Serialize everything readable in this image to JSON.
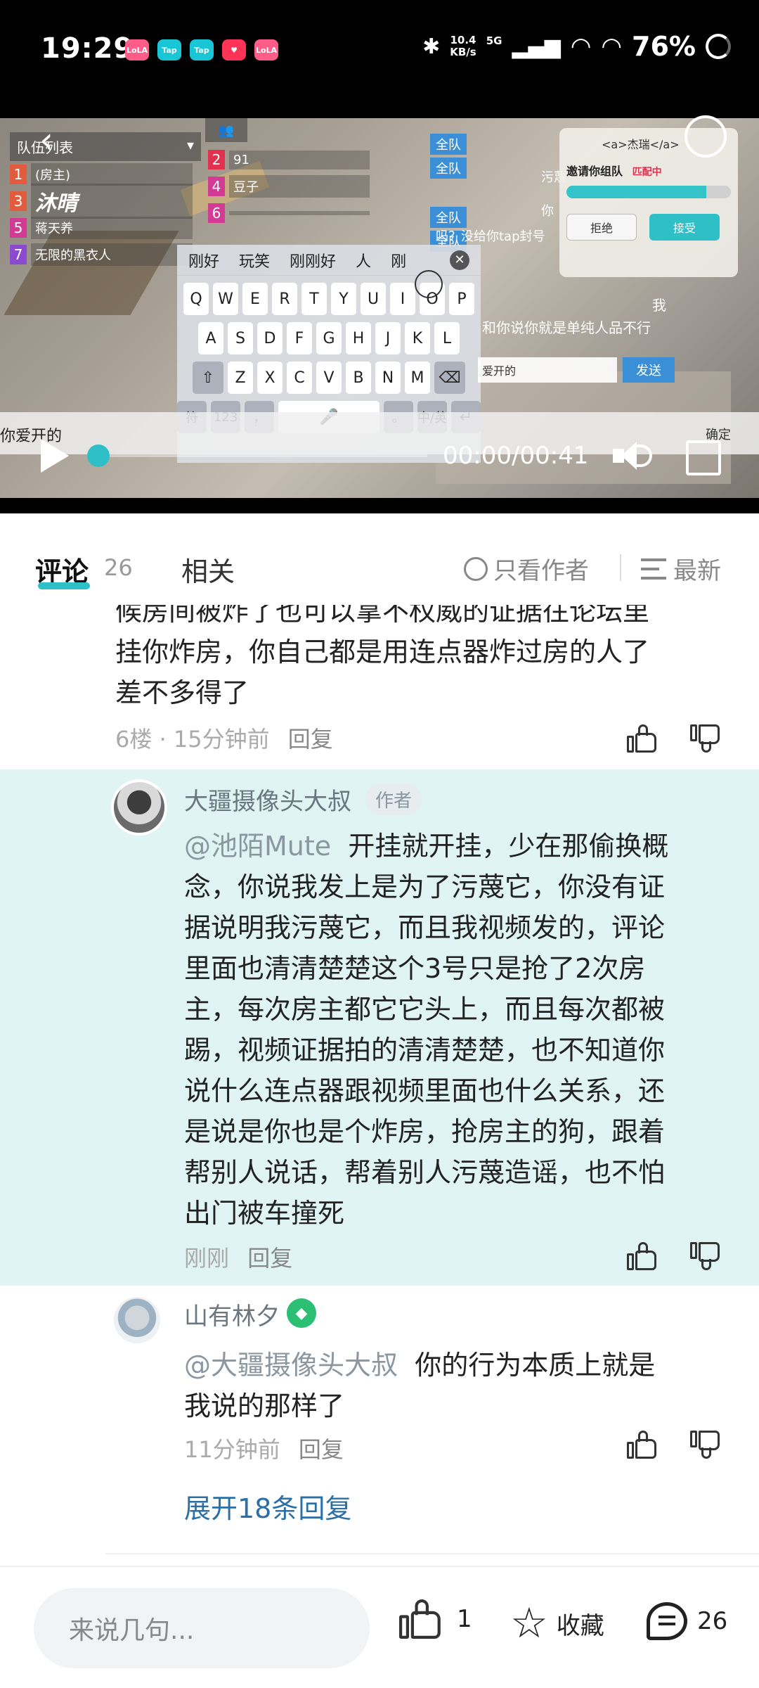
{
  "status_bar": {
    "time": "19:29",
    "apps": [
      {
        "label": "LoLA",
        "color": "#ff5c8a"
      },
      {
        "label": "Tap",
        "color": "#19c6d6"
      },
      {
        "label": "Tap",
        "color": "#19c6d6"
      },
      {
        "label": "♥",
        "color": "#ff3355"
      },
      {
        "label": "LoLA",
        "color": "#ff5c8a"
      }
    ],
    "net_speed_value": "10.4",
    "net_speed_unit": "KB/s",
    "network": "5G",
    "battery": "76%",
    "icons": [
      "bluetooth-icon",
      "signal-icon",
      "wifi-icon",
      "battery-ring-icon"
    ]
  },
  "video": {
    "team_list_label": "队伍列表",
    "team_col1": [
      {
        "num": "1",
        "name": "(房主)",
        "color": "#e25b3d"
      },
      {
        "num": "3",
        "name": "沐晴",
        "color": "#e25b3d"
      },
      {
        "num": "5",
        "name": "蒋天养",
        "color": "#d13b93"
      },
      {
        "num": "7",
        "name": "无限的黑衣人",
        "color": "#8c4ad0"
      }
    ],
    "team_col2": [
      {
        "num": "2",
        "name": "91",
        "color": "#e2314e"
      },
      {
        "num": "4",
        "name": "豆子",
        "color": "#d13b93"
      },
      {
        "num": "6",
        "name": "",
        "color": "#d13b93"
      }
    ],
    "chat_tags": [
      "全队",
      "全队",
      "全队",
      "全队"
    ],
    "chat_lines": [
      "污蔑",
      "你",
      "吗？没给你tap封号",
      "我",
      "和你说你就是单纯人品不行"
    ],
    "invite": {
      "title": "<a>杰瑞</a>",
      "text": "邀请你组队",
      "status": "匹配中",
      "reject": "拒绝",
      "accept": "接受",
      "progress": 0.85
    },
    "keyboard": {
      "suggestions": [
        "刚好",
        "玩笑",
        "刚刚好",
        "人",
        "刚"
      ],
      "row1": [
        "Q",
        "W",
        "E",
        "R",
        "T",
        "Y",
        "U",
        "I",
        "O",
        "P"
      ],
      "row2": [
        "A",
        "S",
        "D",
        "F",
        "G",
        "H",
        "J",
        "K",
        "L"
      ],
      "row3": [
        "Z",
        "X",
        "C",
        "V",
        "B",
        "N",
        "M"
      ],
      "row4": [
        "符",
        "123",
        "，",
        "。",
        "中/英"
      ]
    },
    "send_box": "爱开的",
    "send_button": "发送",
    "input_text": "你爱开的",
    "input_right": "确定",
    "time_display": "00:00/00:41",
    "progress": 0.0
  },
  "tabs": {
    "comments_label": "评论",
    "comments_count": "26",
    "related_label": "相关",
    "author_only_label": "只看作者",
    "sort_label": "最新"
  },
  "comment_partial": {
    "line0": "候房间被炸了也可以拿不权威的证据往论坛里",
    "line1": "挂你炸房，你自己都是用连点器炸过房的人了",
    "line2": "差不多得了",
    "meta": "6楼 · 15分钟前",
    "reply": "回复"
  },
  "reply1": {
    "name": "大疆摄像头大叔",
    "badge": "作者",
    "mention": "@池陌Mute",
    "lines": [
      "开挂就开挂，少在那偷换概",
      "念，你说我发上是为了污蔑它，你没有证",
      "据说明我污蔑它，而且我视频发的，评论",
      "里面也清清楚楚这个3号只是抢了2次房",
      "主，每次房主都它它头上，而且每次都被",
      "踢，视频证据拍的清清楚楚，也不知道你",
      "说什么连点器跟视频里面也什么关系，还",
      "是说是你也是个炸房，抢房主的狗，跟着",
      "帮别人说话，帮着别人污蔑造谣，也不怕",
      "出门被车撞死"
    ],
    "time": "刚刚",
    "reply": "回复"
  },
  "reply2": {
    "name": "山有林夕",
    "mention": "@大疆摄像头大叔",
    "line1": "你的行为本质上就是",
    "line2": "我说的那样了",
    "time": "11分钟前",
    "reply": "回复",
    "expand": "展开18条回复"
  },
  "bottom_bar": {
    "placeholder": "来说几句...",
    "like_count": "1",
    "favorite_label": "收藏",
    "comment_count": "26"
  }
}
